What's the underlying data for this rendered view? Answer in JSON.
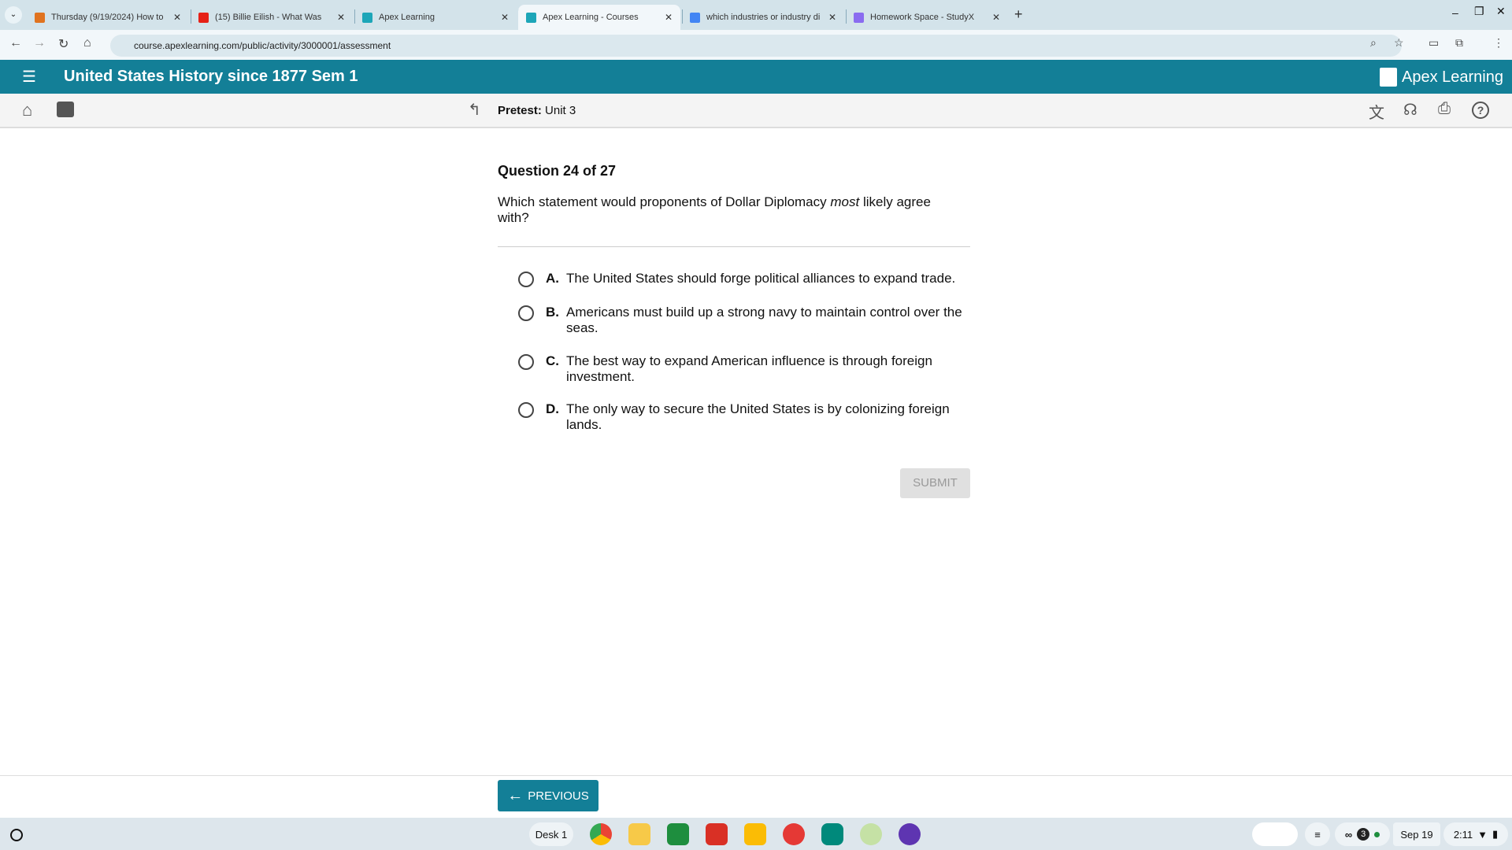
{
  "browser": {
    "tabs": [
      {
        "label": "Thursday (9/19/2024) How to",
        "color": "#e0731f"
      },
      {
        "label": "(15) Billie Eilish - What Was",
        "color": "#e62117"
      },
      {
        "label": "Apex Learning",
        "color": "#1da6b8"
      },
      {
        "label": "Apex Learning - Courses",
        "color": "#1da6b8",
        "active": true
      },
      {
        "label": "which industries or industry di",
        "color": "#4285f4"
      },
      {
        "label": "Homework Space - StudyX",
        "color": "#8a6cf0"
      }
    ],
    "url": "course.apexlearning.com/public/activity/3000001/assessment"
  },
  "header": {
    "course_title": "United States History since 1877 Sem 1",
    "brand": "Apex Learning",
    "color": "#137f97"
  },
  "subheader": {
    "label": "Pretest:",
    "value": "Unit 3"
  },
  "question": {
    "counter": "Question 24 of 27",
    "text_before": "Which statement would proponents of Dollar Diplomacy ",
    "text_emph": "most",
    "text_after": " likely agree with?",
    "options": [
      {
        "letter": "A.",
        "text": "The United States should forge political alliances to expand trade."
      },
      {
        "letter": "B.",
        "text": "Americans must build up a strong navy to maintain control over the seas."
      },
      {
        "letter": "C.",
        "text": "The best way to expand American influence is through foreign investment."
      },
      {
        "letter": "D.",
        "text": "The only way to secure the United States is by colonizing foreign lands."
      }
    ],
    "submit": "SUBMIT",
    "previous": "PREVIOUS"
  },
  "taskbar": {
    "desk": "Desk 1",
    "notif_count": "3",
    "date": "Sep 19",
    "time": "2:11"
  }
}
